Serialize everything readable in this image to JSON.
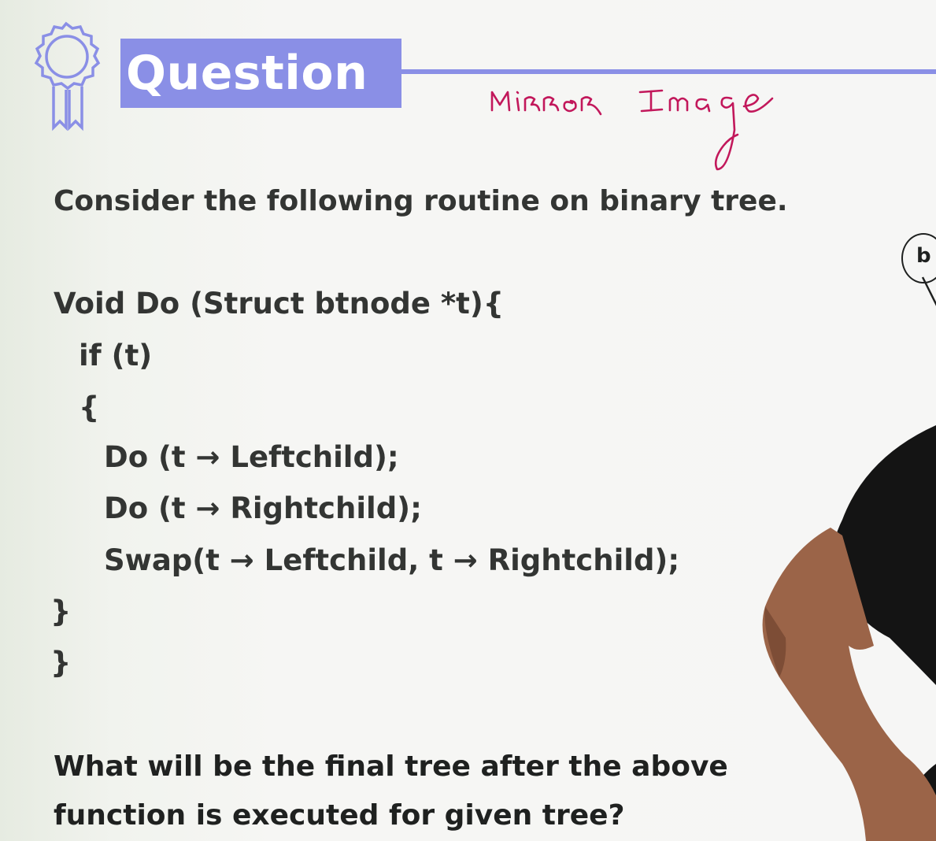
{
  "header": {
    "title": "Question",
    "annotation": "Mirror Image"
  },
  "content": {
    "intro": "Consider the following routine on binary tree.",
    "code": [
      "Void Do (Struct btnode *t){",
      "if (t)",
      "{",
      "Do (t → Leftchild);",
      "Do (t → Rightchild);",
      "Swap(t → Leftchild, t → Rightchild);",
      "}",
      "}"
    ],
    "question_line1": "What will be the final tree after the above",
    "question_line2": "function is executed for given tree?"
  },
  "diagram": {
    "node_label": "b"
  },
  "icons": {
    "badge": "award-ribbon-icon"
  },
  "colors": {
    "accent": "#8a8fe6",
    "annotation_ink": "#c2185b",
    "text": "#333533"
  }
}
